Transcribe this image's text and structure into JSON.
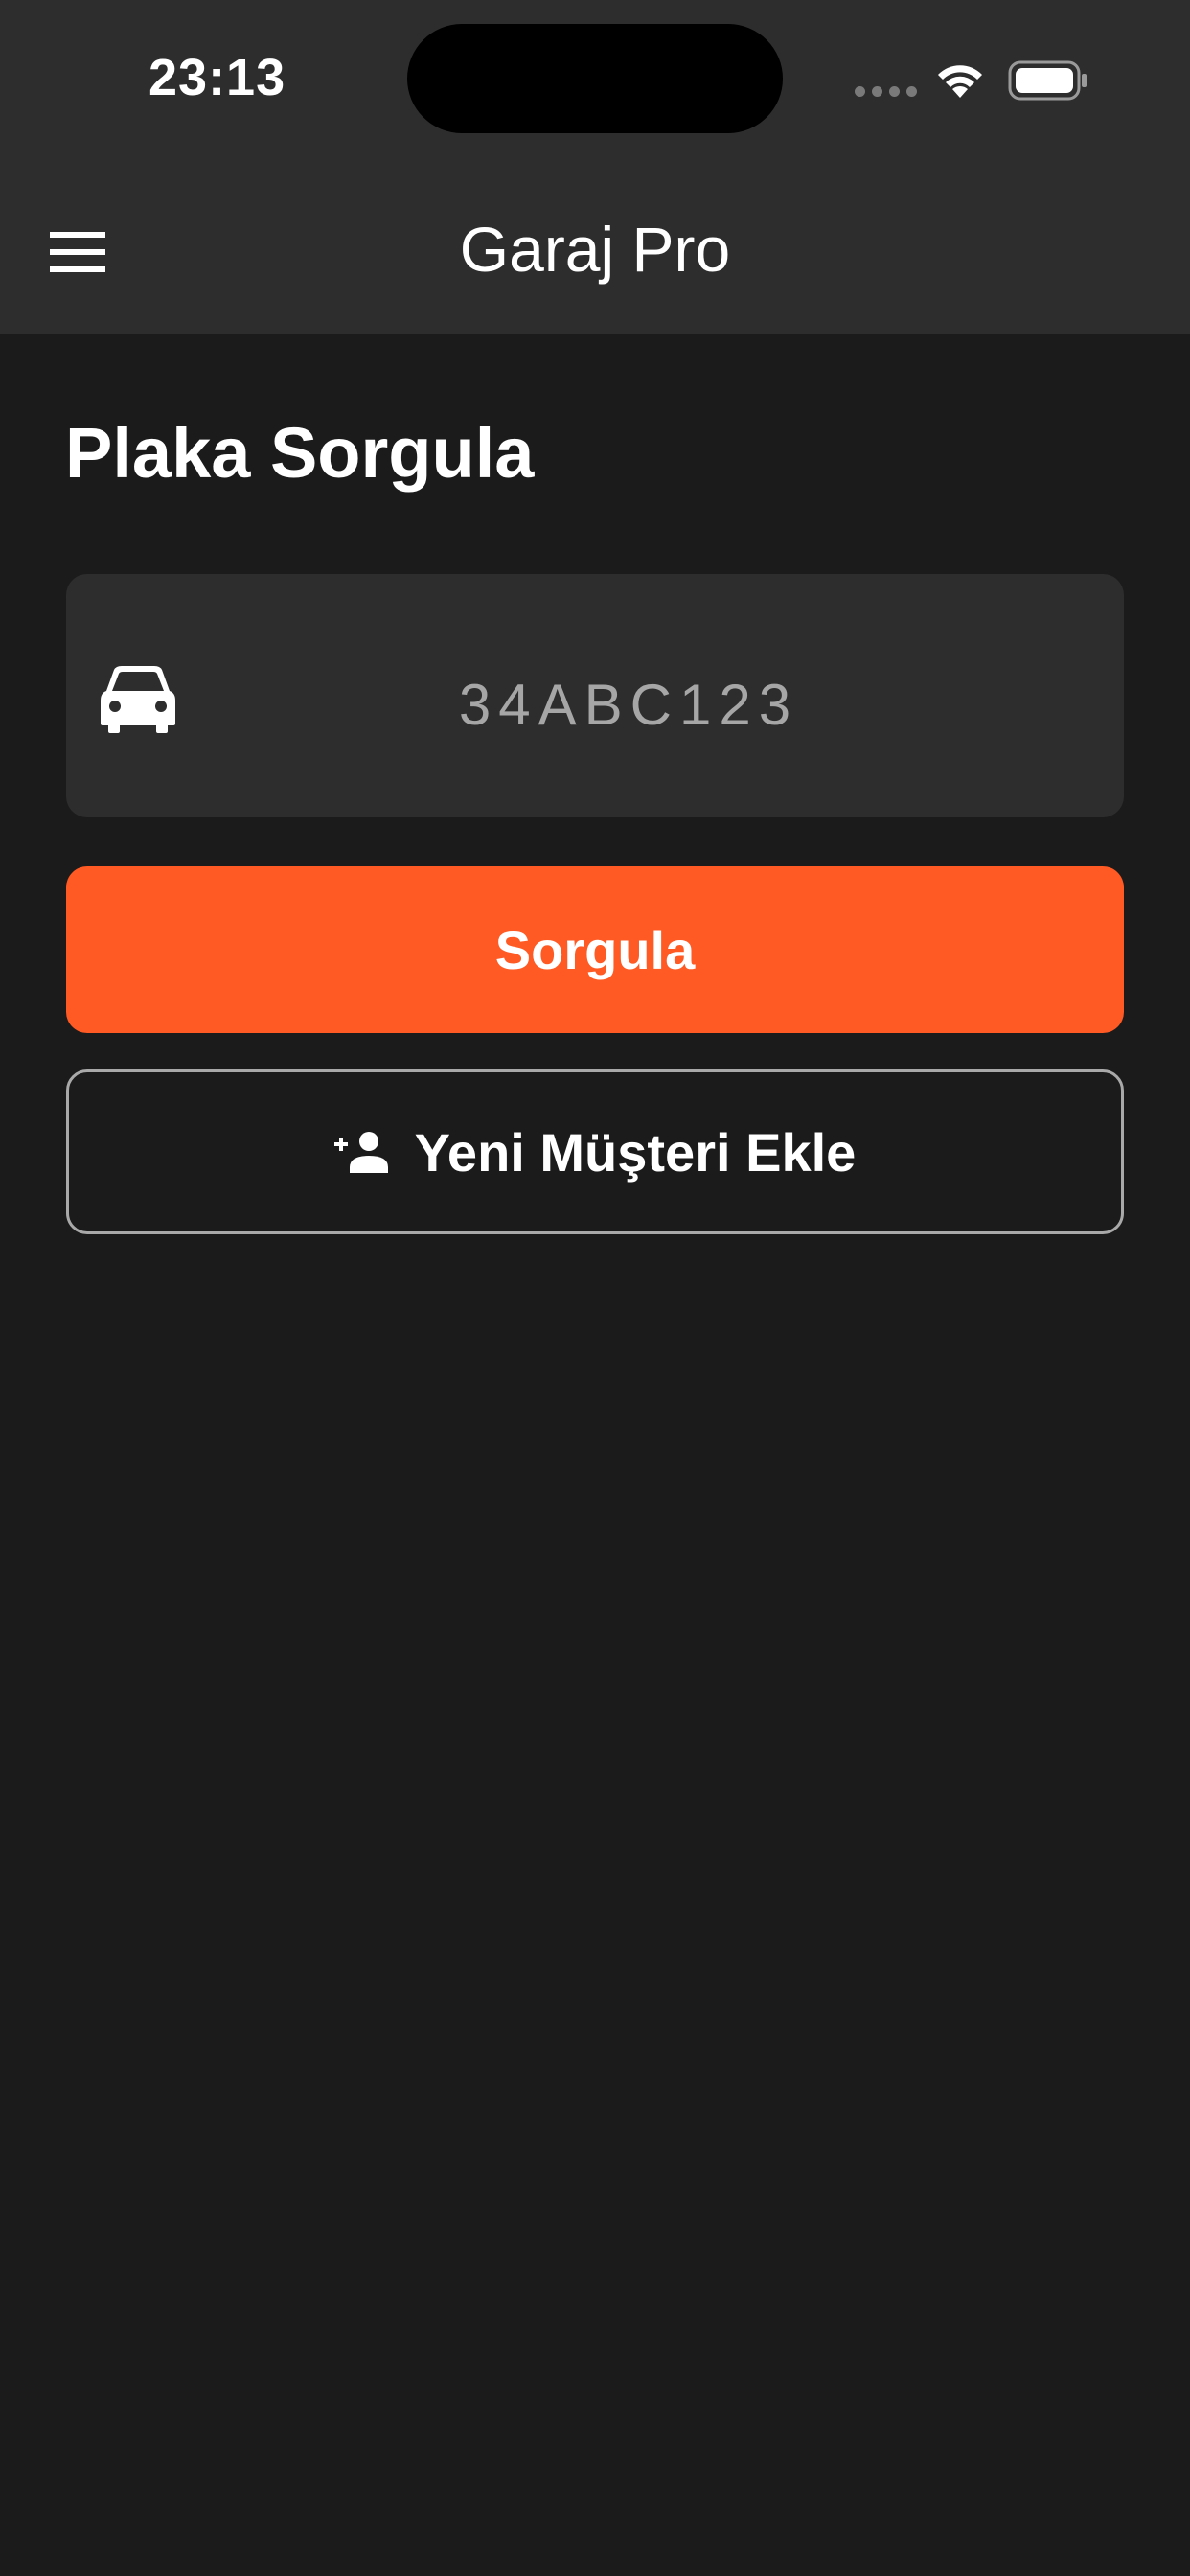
{
  "status_bar": {
    "time": "23:13",
    "icons": [
      "signal-icon",
      "wifi-icon",
      "battery-icon"
    ]
  },
  "app_bar": {
    "title": "Garaj Pro",
    "menu_icon": "menu-icon"
  },
  "main": {
    "page_title": "Plaka Sorgula",
    "plate_input": {
      "icon": "car-icon",
      "placeholder": "34ABC123",
      "value": ""
    },
    "query_button_label": "Sorgula",
    "add_customer_button": {
      "icon": "person-add-icon",
      "label": "Yeni Müşteri Ekle"
    }
  },
  "colors": {
    "background": "#1b1b1b",
    "bar_background": "#2d2d2d",
    "accent": "#ff5a24",
    "outline": "#a9a9a9",
    "placeholder_text": "#a6a6a6"
  }
}
